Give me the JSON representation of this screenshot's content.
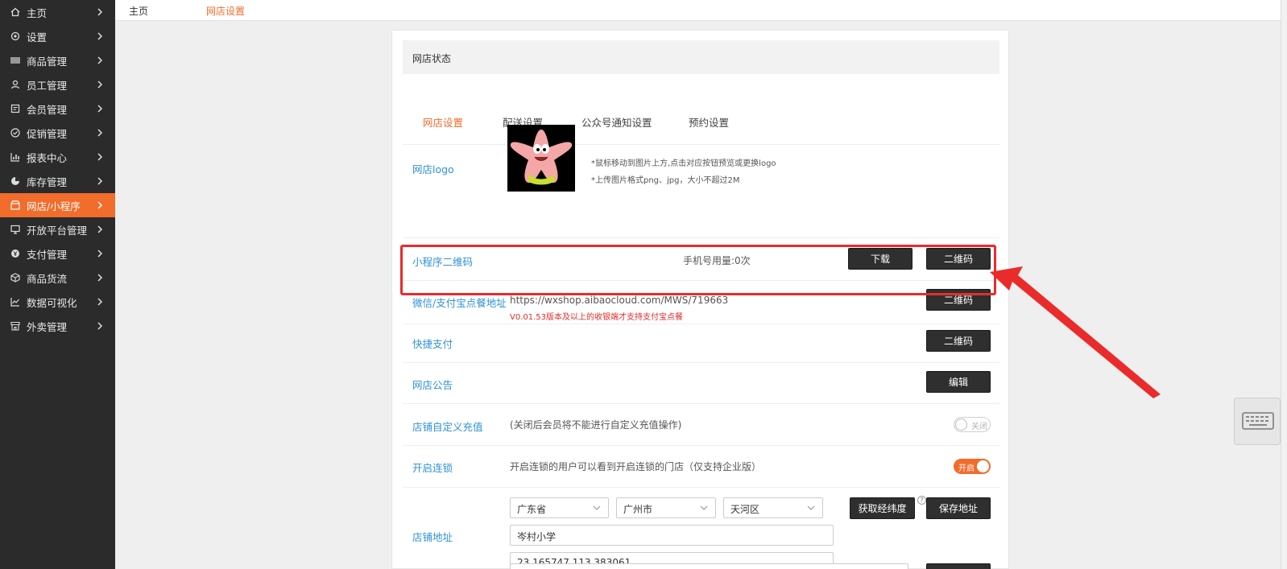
{
  "sidebar": {
    "items": [
      {
        "label": "主页",
        "icon": "home-icon"
      },
      {
        "label": "设置",
        "icon": "gear-icon"
      },
      {
        "label": "商品管理",
        "icon": "barcode-icon"
      },
      {
        "label": "员工管理",
        "icon": "user-icon"
      },
      {
        "label": "会员管理",
        "icon": "member-card-icon"
      },
      {
        "label": "促销管理",
        "icon": "check-circle-icon"
      },
      {
        "label": "报表中心",
        "icon": "bar-chart-icon"
      },
      {
        "label": "库存管理",
        "icon": "pie-chart-icon"
      },
      {
        "label": "网店/小程序",
        "icon": "store-icon",
        "active": true
      },
      {
        "label": "开放平台管理",
        "icon": "monitor-icon"
      },
      {
        "label": "支付管理",
        "icon": "yen-coin-icon"
      },
      {
        "label": "商品货流",
        "icon": "cube-icon"
      },
      {
        "label": "数据可视化",
        "icon": "line-chart-icon"
      },
      {
        "label": "外卖管理",
        "icon": "shop-icon"
      }
    ]
  },
  "breadcrumb": {
    "home": "主页",
    "current": "网店设置"
  },
  "panel": {
    "title": "网店状态",
    "tabs": [
      "网店设置",
      "配送设置",
      "公众号通知设置",
      "预约设置"
    ],
    "logo": {
      "label": "网店logo",
      "hint1": "*鼠标移动到图片上方,点击对应按钮预览或更换logo",
      "hint2": "*上传图片格式png、jpg，大小不超过2M"
    },
    "miniprogram": {
      "label": "小程序二维码",
      "usage": "手机号用量:0次",
      "download_btn": "下载",
      "qr_btn": "二维码"
    },
    "wechat_pay": {
      "label": "微信/支付宝点餐地址",
      "url": "https://wxshop.aibaocloud.com/MWS/719663",
      "note": "V0.01.53版本及以上的收银端才支持支付宝点餐",
      "qr_btn": "二维码"
    },
    "quick_pay": {
      "label": "快捷支付",
      "qr_btn": "二维码"
    },
    "notice": {
      "label": "网店公告",
      "edit_btn": "编辑"
    },
    "recharge": {
      "label": "店铺自定义充值",
      "desc": "(关闭后会员将不能进行自定义充值操作)",
      "toggle": "关闭"
    },
    "chain": {
      "label": "开启连锁",
      "desc": "开启连锁的用户可以看到开启连锁的门店（仅支持企业版）",
      "toggle": "开启"
    },
    "address": {
      "label": "店铺地址",
      "province": "广东省",
      "city": "广州市",
      "district": "天河区",
      "detail": "岑村小学",
      "coords": "23.165747,113.383061",
      "locate_btn": "获取经纬度",
      "save_btn": "保存地址",
      "help": "?"
    }
  },
  "colors": {
    "accent": "#f26c2b",
    "label_blue": "#3092d6",
    "highlight_red": "#ea2b2b",
    "sidebar_bg": "#2b2b2b"
  }
}
